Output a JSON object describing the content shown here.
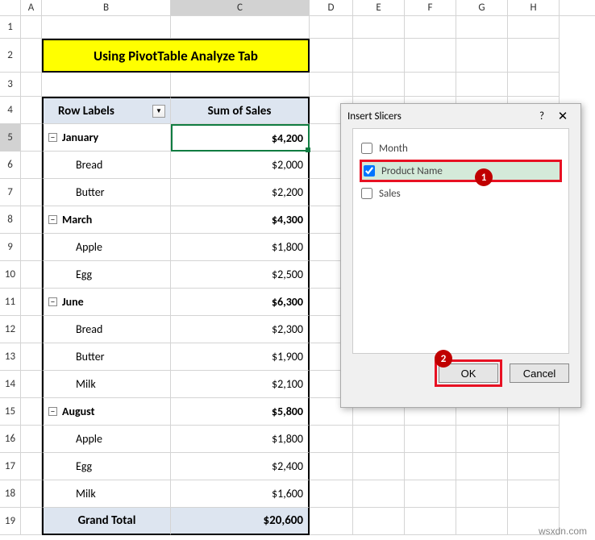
{
  "columns": [
    "A",
    "B",
    "C",
    "D",
    "E",
    "F",
    "G",
    "H"
  ],
  "rows": [
    "1",
    "2",
    "3",
    "4",
    "5",
    "6",
    "7",
    "8",
    "9",
    "10",
    "11",
    "12",
    "13",
    "14",
    "15",
    "16",
    "17",
    "18",
    "19"
  ],
  "active_row": "5",
  "active_col": "C",
  "title": "Using PivotTable Analyze Tab",
  "pivot": {
    "header_left": "Row Labels",
    "header_right": "Sum of Sales",
    "grandtotal_label": "Grand Total",
    "grandtotal_value": "$20,600",
    "groups": [
      {
        "label": "January",
        "total": "$4,200",
        "items": [
          {
            "name": "Bread",
            "value": "$2,000"
          },
          {
            "name": "Butter",
            "value": "$2,200"
          }
        ]
      },
      {
        "label": "March",
        "total": "$4,300",
        "items": [
          {
            "name": "Apple",
            "value": "$1,800"
          },
          {
            "name": "Egg",
            "value": "$2,500"
          }
        ]
      },
      {
        "label": "June",
        "total": "$6,300",
        "items": [
          {
            "name": "Bread",
            "value": "$2,300"
          },
          {
            "name": "Butter",
            "value": "$1,900"
          },
          {
            "name": "Milk",
            "value": "$2,100"
          }
        ]
      },
      {
        "label": "August",
        "total": "$5,800",
        "items": [
          {
            "name": "Apple",
            "value": "$1,800"
          },
          {
            "name": "Egg",
            "value": "$2,400"
          },
          {
            "name": "Milk",
            "value": "$1,600"
          }
        ]
      }
    ]
  },
  "dialog": {
    "title": "Insert Slicers",
    "help": "?",
    "close": "✕",
    "fields": [
      {
        "name": "Month",
        "checked": false,
        "selected": false
      },
      {
        "name": "Product Name",
        "checked": true,
        "selected": true,
        "highlighted": true
      },
      {
        "name": "Sales",
        "checked": false,
        "selected": false
      }
    ],
    "ok_label": "OK",
    "cancel_label": "Cancel"
  },
  "callouts": {
    "c1": "1",
    "c2": "2"
  },
  "watermark": "wsxdn.com",
  "expand_glyph": "−",
  "filter_glyph": "▼"
}
